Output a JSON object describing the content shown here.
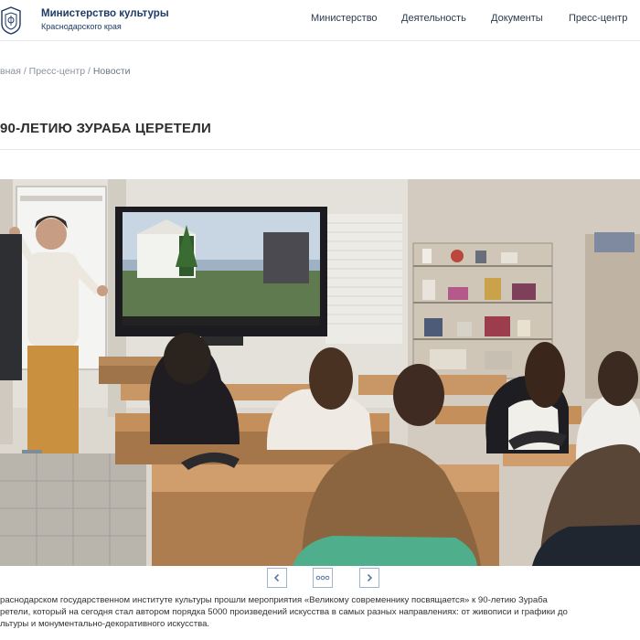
{
  "header": {
    "title": "Министерство культуры",
    "subtitle": "Краснодарского края",
    "nav": [
      {
        "label": "Министерство"
      },
      {
        "label": "Деятельность"
      },
      {
        "label": "Документы"
      },
      {
        "label": "Пресс-центр"
      }
    ]
  },
  "breadcrumb": {
    "items": [
      "вная",
      "Пресс-центр",
      "Новости"
    ],
    "separator": "/"
  },
  "page": {
    "title": "90-ЛЕТИЮ ЗУРАБА ЦЕРЕТЕЛИ"
  },
  "slider": {
    "prev_icon": "chevron-left-icon",
    "dots_icon": "dots-icon",
    "next_icon": "chevron-right-icon"
  },
  "caption": {
    "lines": [
      "раснодарском государственном институте культуры прошли мероприятия «Великому современнику посвящается» к 90-летию Зураба",
      "ретели, который на сегодня стал автором порядка 5000 произведений искусства в самых разных направлениях: от живописи и графики до",
      "льтуры и монументально-декоративного искусства."
    ]
  },
  "colors": {
    "brand": "#1d3a66",
    "nav_text": "#2a3a4e",
    "button_border": "#9fb4cf"
  }
}
